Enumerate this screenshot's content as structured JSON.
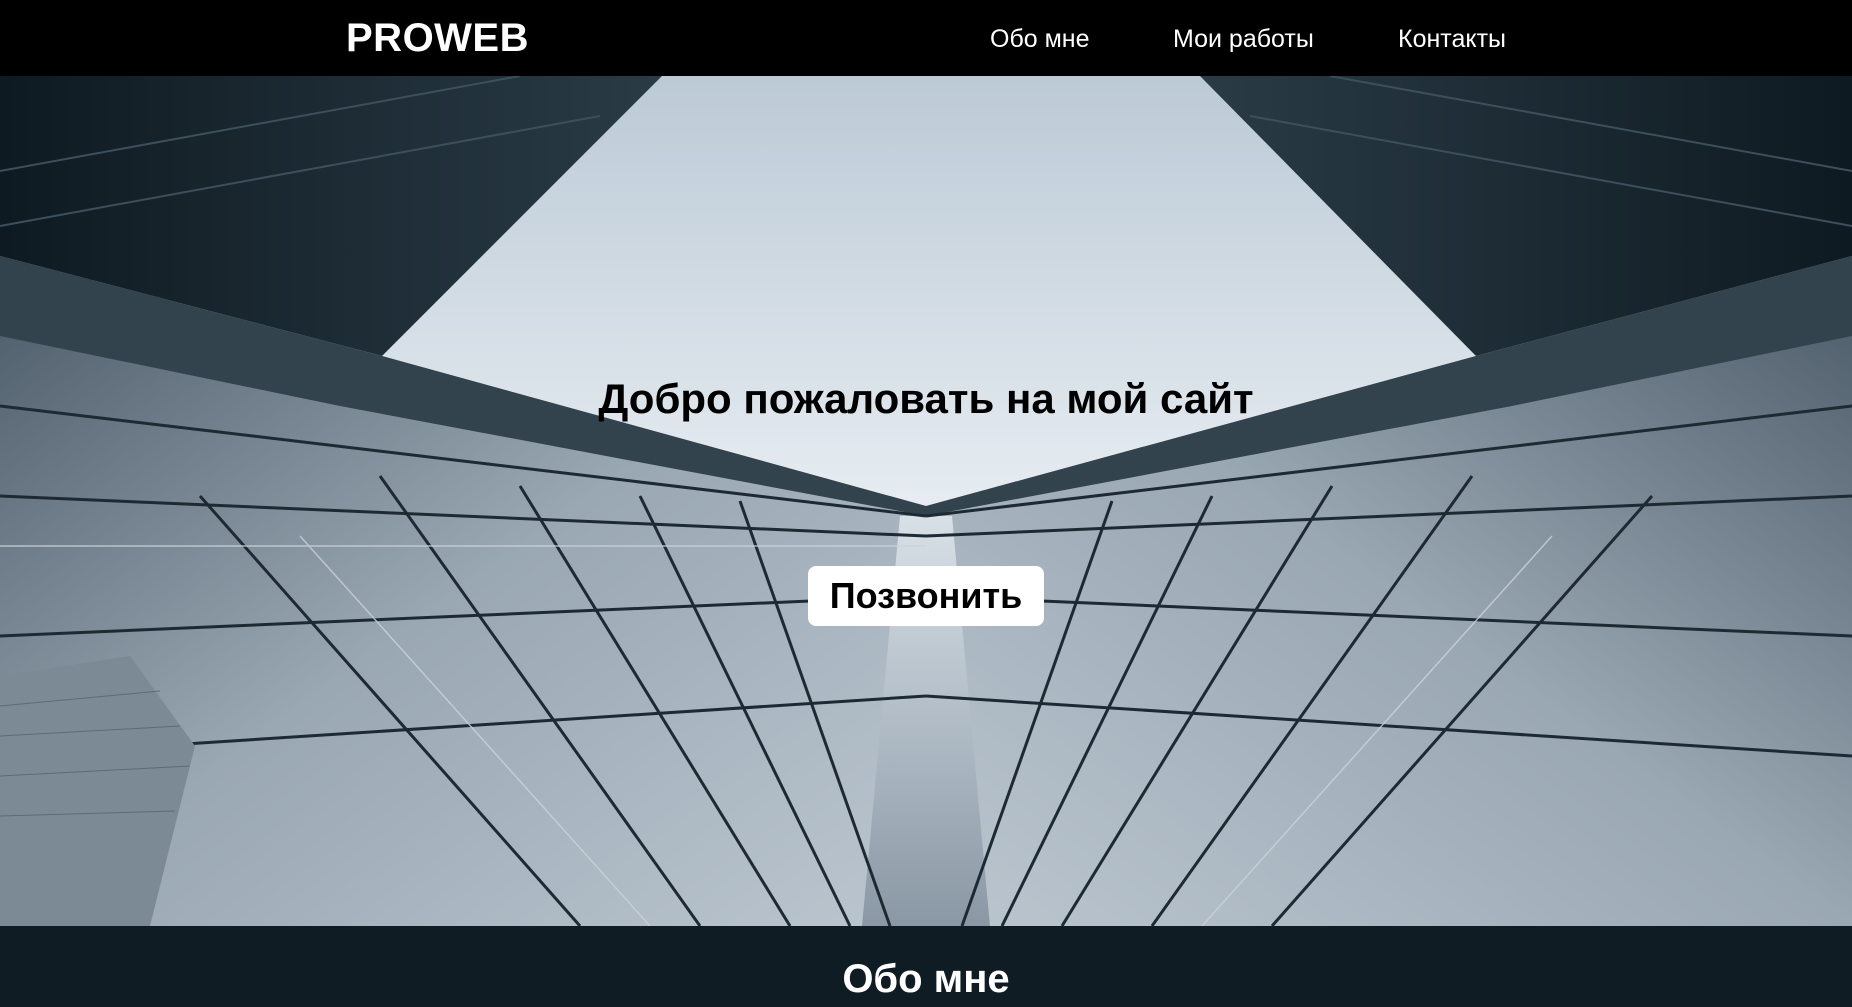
{
  "header": {
    "logo": "PROWEB",
    "nav": [
      {
        "label": "Обо мне"
      },
      {
        "label": "Мои работы"
      },
      {
        "label": "Контакты"
      }
    ]
  },
  "hero": {
    "title": "Добро пожаловать на мой сайт",
    "button_label": "Позвонить",
    "background_image": "skyscraper-glass-facade-looking-up"
  },
  "about": {
    "title": "Обо мне"
  },
  "colors": {
    "header_bg": "#000000",
    "section_bg": "#0f1c24",
    "text_light": "#ffffff",
    "text_dark": "#000000"
  }
}
